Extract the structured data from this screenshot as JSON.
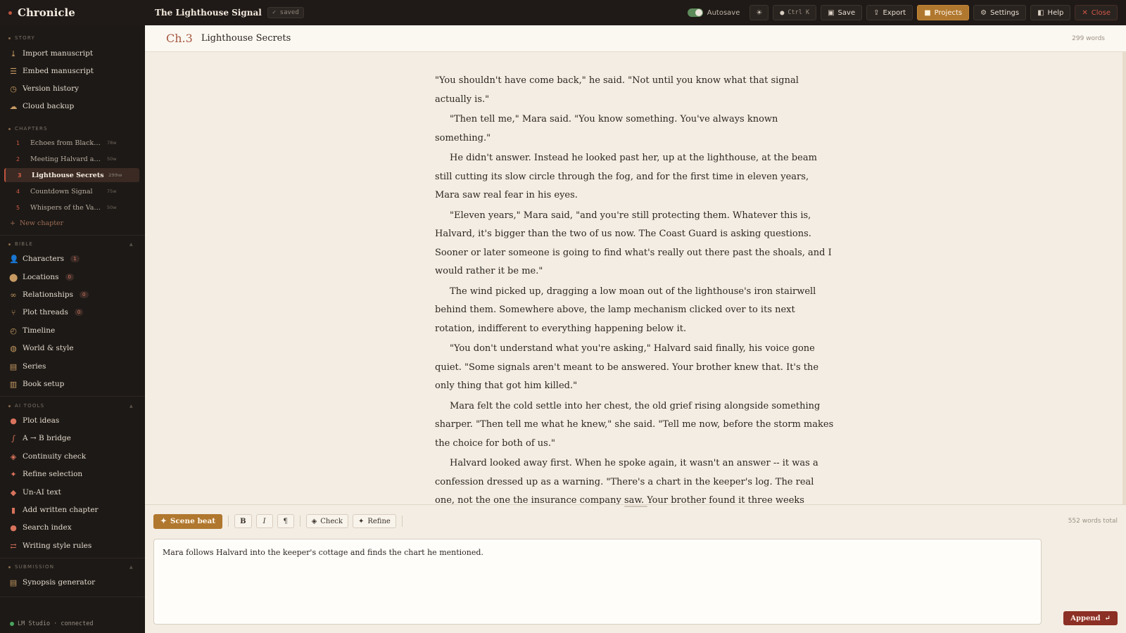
{
  "app": {
    "name": "Chronicle"
  },
  "document": {
    "title": "The Lighthouse Signal",
    "save_status": "✓ saved"
  },
  "toolbar": {
    "autosave_label": "Autosave",
    "autosave_on": true,
    "shortcut_label": "Ctrl K",
    "save_label": "Save",
    "export_label": "Export",
    "projects_label": "Projects",
    "settings_label": "Settings",
    "help_label": "Help",
    "close_label": "Close"
  },
  "sidebar": {
    "story_label": "STORY",
    "story_items": [
      {
        "label": "Import manuscript",
        "icon": "download-icon"
      },
      {
        "label": "Embed manuscript",
        "icon": "database-icon"
      },
      {
        "label": "Version history",
        "icon": "history-icon"
      },
      {
        "label": "Cloud backup",
        "icon": "cloud-icon"
      }
    ],
    "chapters_label": "CHAPTERS",
    "chapters": [
      {
        "num": "1",
        "title": "Echoes from Blackrock",
        "words": "78w"
      },
      {
        "num": "2",
        "title": "Meeting Halvard at t...",
        "words": "50w"
      },
      {
        "num": "3",
        "title": "Lighthouse Secrets",
        "words": "299w",
        "active": true
      },
      {
        "num": "4",
        "title": "Countdown Signal",
        "words": "75w"
      },
      {
        "num": "5",
        "title": "Whispers of the Vani...",
        "words": "50w"
      }
    ],
    "new_chapter_label": "New chapter",
    "bible_label": "BIBLE",
    "bible_items": [
      {
        "label": "Characters",
        "icon": "people-icon",
        "count": "1"
      },
      {
        "label": "Locations",
        "icon": "map-pin-icon",
        "count": "0"
      },
      {
        "label": "Relationships",
        "icon": "link-icon",
        "count": "0"
      },
      {
        "label": "Plot threads",
        "icon": "branch-icon",
        "count": "0"
      },
      {
        "label": "Timeline",
        "icon": "clock-icon"
      },
      {
        "label": "World & style",
        "icon": "globe-icon"
      },
      {
        "label": "Series",
        "icon": "books-icon"
      },
      {
        "label": "Book setup",
        "icon": "book-icon"
      }
    ],
    "ai_label": "AI TOOLS",
    "ai_items": [
      {
        "label": "Plot ideas",
        "icon": "lightbulb-icon"
      },
      {
        "label": "A → B bridge",
        "icon": "route-icon"
      },
      {
        "label": "Continuity check",
        "icon": "shield-icon"
      },
      {
        "label": "Refine selection",
        "icon": "sparkle-icon"
      },
      {
        "label": "Un-AI text",
        "icon": "eraser-icon"
      },
      {
        "label": "Add written chapter",
        "icon": "file-plus-icon"
      },
      {
        "label": "Search index",
        "icon": "search-icon"
      },
      {
        "label": "Writing style rules",
        "icon": "rules-icon"
      }
    ],
    "submission_label": "SUBMISSION",
    "submission_items": [
      {
        "label": "Synopsis generator",
        "icon": "document-icon"
      }
    ],
    "status": "LM Studio · connected"
  },
  "chapter": {
    "number": "Ch.3",
    "title": "Lighthouse Secrets",
    "word_count": "299 words",
    "paragraphs": [
      "\"You shouldn't have come back,\" he said. \"Not until you know what that signal actually is.\"",
      "\"Then tell me,\" Mara said. \"You know something. You've always known something.\"",
      "He didn't answer. Instead he looked past her, up at the lighthouse, at the beam still cutting its slow circle through the fog, and for the first time in eleven years, Mara saw real fear in his eyes.",
      "\"Eleven years,\" Mara said, \"and you're still protecting them. Whatever this is, Halvard, it's bigger than the two of us now. The Coast Guard is asking questions. Sooner or later someone is going to find what's really out there past the shoals, and I would rather it be me.\"",
      "The wind picked up, dragging a low moan out of the lighthouse's iron stairwell behind them. Somewhere above, the lamp mechanism clicked over to its next rotation, indifferent to everything happening below it.",
      "\"You don't understand what you're asking,\" Halvard said finally, his voice gone quiet. \"Some signals aren't meant to be answered. Your brother knew that. It's the only thing that got him killed.\"",
      "Mara felt the cold settle into her chest, the old grief rising alongside something sharper. \"Then tell me what he knew,\" she said. \"Tell me now, before the storm makes the choice for both of us.\"",
      "Halvard looked away first. When he spoke again, it wasn't an answer -- it was a confession dressed up as a warning. \"There's a chart in the keeper's log. The real one, not the one the insurance company saw. Your brother found it three weeks before he disappeared, and once he started asking the same questions you're asking now, the signal changed. It started answering back.\""
    ]
  },
  "composer": {
    "scene_beat_label": "Scene beat",
    "bold_label": "B",
    "italic_label": "I",
    "para_label": "¶",
    "check_label": "Check",
    "refine_label": "Refine",
    "total_words": "552 words total",
    "beat_text": "Mara follows Halvard into the keeper's cottage and finds the chart he mentioned.",
    "append_label": "Append"
  },
  "colors": {
    "accent": "#b0772e",
    "danger": "#8c2f24",
    "sidebar_bg": "#1d1916",
    "paper_bg": "#f3ede3"
  }
}
